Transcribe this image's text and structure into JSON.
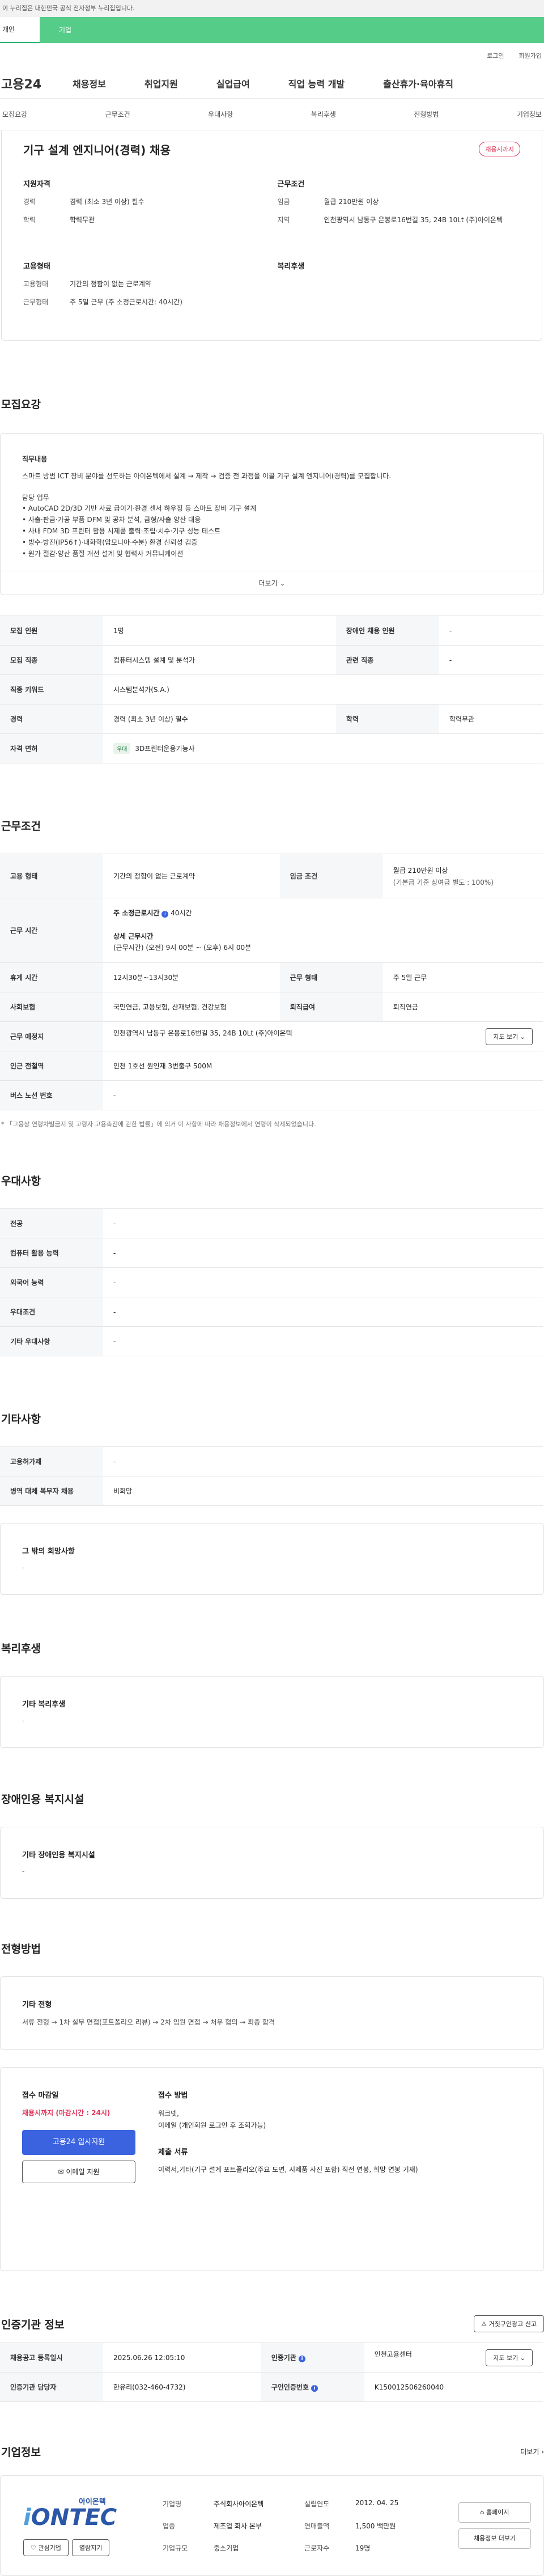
{
  "gov_banner": "이 누리집은 대한민국 공식 전자정부 누리집입니다.",
  "top_tabs": {
    "personal": "개인",
    "company": "기업"
  },
  "utility": {
    "login": "로그인",
    "signup": "회원가입"
  },
  "logo": "고용24",
  "gnb": [
    "채용정보",
    "취업지원",
    "실업급여",
    "직업 능력 개발",
    "출산휴가·육아휴직"
  ],
  "anchors": [
    "모집요강",
    "근무조건",
    "우대사항",
    "복리후생",
    "전형방법",
    "기업정보"
  ],
  "summary": {
    "title": "기구 설계 엔지니어(경력) 채용",
    "badge": "채용시까지",
    "qual_title": "지원자격",
    "career_k": "경력",
    "career_v": "경력 (최소 3년 이상) 필수",
    "edu_k": "학력",
    "edu_v": "학력무관",
    "work_title": "근무조건",
    "wage_k": "임금",
    "wage_v": "월급 210만원 이상",
    "region_k": "지역",
    "region_v": "인천광역시 남동구 은봉로16번길 35, 24B 10Lt (주)아이온텍",
    "emp_title": "고용형태",
    "emptype_k": "고용형태",
    "emptype_v": "기간의 정함이 없는 근로계약",
    "worktype_k": "근무형태",
    "worktype_v": "주 5일 근무 (주 소정근로시간: 40시간)",
    "welfare_title": "복리후생"
  },
  "recruit": {
    "title": "모집요강",
    "desc_label": "직무내용",
    "desc_intro": "스마트 방범 ICT 장비 분야를 선도하는 아이온텍에서 설계 → 제작 → 검증 전 과정을 이끌 기구 설계 엔지니어(경력)를 모집합니다.",
    "duty_label": "담당 업무",
    "duties": [
      "• AutoCAD 2D/3D 기반 사료 급이기·환경 센서 하우징 등 스마트 장비 기구 설계",
      "• 사출·판금·가공 부품 DFM 및 공차 분석, 금형/사출 양산 대응",
      "• 사내 FDM 3D 프린터 활용 시제품 출력·조립·치수·기구 성능 테스트",
      "• 방수·방진(IP56↑)·내화학(암모니아·수분) 환경 신뢰성 검증",
      "• 원가 절감·양산 품질 개선 설계 및 협력사 커뮤니케이션"
    ],
    "more": "더보기",
    "rows": [
      {
        "k1": "모집 인원",
        "v1": "1명",
        "k2": "장애인 채용 인원",
        "v2": "-"
      },
      {
        "k1": "모집 직종",
        "v1": "컴퓨터시스템 설계 및 분석가",
        "k2": "관련 직종",
        "v2": "-"
      },
      {
        "k1": "직종 키워드",
        "v1": "시스템분석가(S.A.)"
      },
      {
        "k1": "경력",
        "v1": "경력 (최소 3년 이상) 필수",
        "k2": "학력",
        "v2": "학력무관"
      },
      {
        "k1": "자격 면허",
        "tag": "우대",
        "v1": "3D프린터운용기능사"
      }
    ]
  },
  "conditions": {
    "title": "근무조건",
    "emp_k": "고용 형태",
    "emp_v": "기간의 정함이 없는 근로계약",
    "wage_k": "임금 조건",
    "wage_v1": "월급 210만원 이상",
    "wage_v2": "(기본급 기준 상여금 별도 : 100%)",
    "time_k": "근무 시간",
    "time_v1": "주 소정근로시간",
    "time_v1b": "40시간",
    "time_v2": "상세 근무시간",
    "time_v3": "(근무시간) (오전) 9시 00분 ~ (오후) 6시 00분",
    "rest_k": "휴게 시간",
    "rest_v": "12시30분~13시30분",
    "form_k": "근무 형태",
    "form_v": "주 5일 근무",
    "ins_k": "사회보험",
    "ins_v": "국민연금, 고용보험, 산재보험, 건강보험",
    "ret_k": "퇴직급여",
    "ret_v": "퇴직연금",
    "place_k": "근무 예정지",
    "place_v": "인천광역시 남동구 은봉로16번길 35, 24B 10Lt (주)아이온텍",
    "map_btn": "지도 보기",
    "station_k": "인근 전철역",
    "station_v": "인천 1호선 원인재 3번출구 500M",
    "bus_k": "버스 노선 번호",
    "bus_v": "-",
    "note": "* 「고용상 연령차별금지 및 고령자 고용촉진에 관한 법률」에 의거 이 사항에 따라 채용정보에서 연령이 삭제되었습니다."
  },
  "prefer": {
    "title": "우대사항",
    "rows": [
      {
        "k": "전공",
        "v": "-"
      },
      {
        "k": "컴퓨터 활용 능력",
        "v": "-"
      },
      {
        "k": "외국어 능력",
        "v": "-"
      },
      {
        "k": "우대조건",
        "v": "-"
      },
      {
        "k": "기타 우대사항",
        "v": "-"
      }
    ]
  },
  "etc": {
    "title": "기타사항",
    "rows": [
      {
        "k": "고용허가제",
        "v": "-"
      },
      {
        "k": "병역 대체 복무자 채용",
        "v": "비희망"
      }
    ],
    "other_label": "그 밖의 희망사항",
    "other_value": "-"
  },
  "welfare": {
    "title": "복리후생",
    "label": "기타 복리후생",
    "value": "-"
  },
  "disability": {
    "title": "장애인용 복지시설",
    "label": "기타 장애인용 복지시설",
    "value": "-"
  },
  "process": {
    "title": "전형방법",
    "label": "기타 전형",
    "value": "서류 전형 → 1차 실무 면접(포트폴리오 리뷰) → 2차 임원 면접 → 처우 협의 → 최종 합격",
    "deadline_label": "접수 마감일",
    "deadline_value": "채용시까지 (마감시간 : 24시)",
    "apply_btn": "고용24 입사지원",
    "email_btn": "이메일 지원",
    "method_label": "접수 방법",
    "method_v1": "워크넷,",
    "method_v2": "이메일 (개인회원 로그인 후 조회가능)",
    "docs_label": "제출 서류",
    "docs_value": "이력서,기타(기구 설계 포트폴리오(주요 도면, 시제품 사진 포함) 직전 연봉, 희망 연봉 기재)"
  },
  "agency": {
    "title": "인증기관 정보",
    "report_btn": "거짓구인광고 신고",
    "reg_k": "채용공고 등록일시",
    "reg_v": "2025.06.26 12:05:10",
    "org_k": "인증기관",
    "org_v": "인천고용센터",
    "map_btn": "지도 보기",
    "mgr_k": "인증기관 담당자",
    "mgr_v": "한유리(032-460-4732)",
    "cert_k": "구인인증번호",
    "cert_v": "K150012506260040"
  },
  "company": {
    "title": "기업정보",
    "more": "더보기",
    "logo_kr": "아이온텍",
    "logo_en": "ONTEC",
    "interest_btn": "관심기업",
    "follow_btn": "열람지기",
    "name_k": "기업명",
    "name_v": "주식회사아이온텍",
    "found_k": "설립연도",
    "found_v": "2012. 04. 25",
    "ind_k": "업종",
    "ind_v": "제조업 회사 본부",
    "sales_k": "연매출액",
    "sales_v": "1,500 백만원",
    "size_k": "기업규모",
    "size_v": "중소기업",
    "emp_k": "근로자수",
    "emp_v": "19명",
    "home_btn": "홈페이지",
    "jobs_btn": "채용정보 더보기"
  },
  "colors": {
    "accent": "#3b63e0",
    "tab_green": "#55cc88",
    "badge_red": "#e0355a"
  }
}
